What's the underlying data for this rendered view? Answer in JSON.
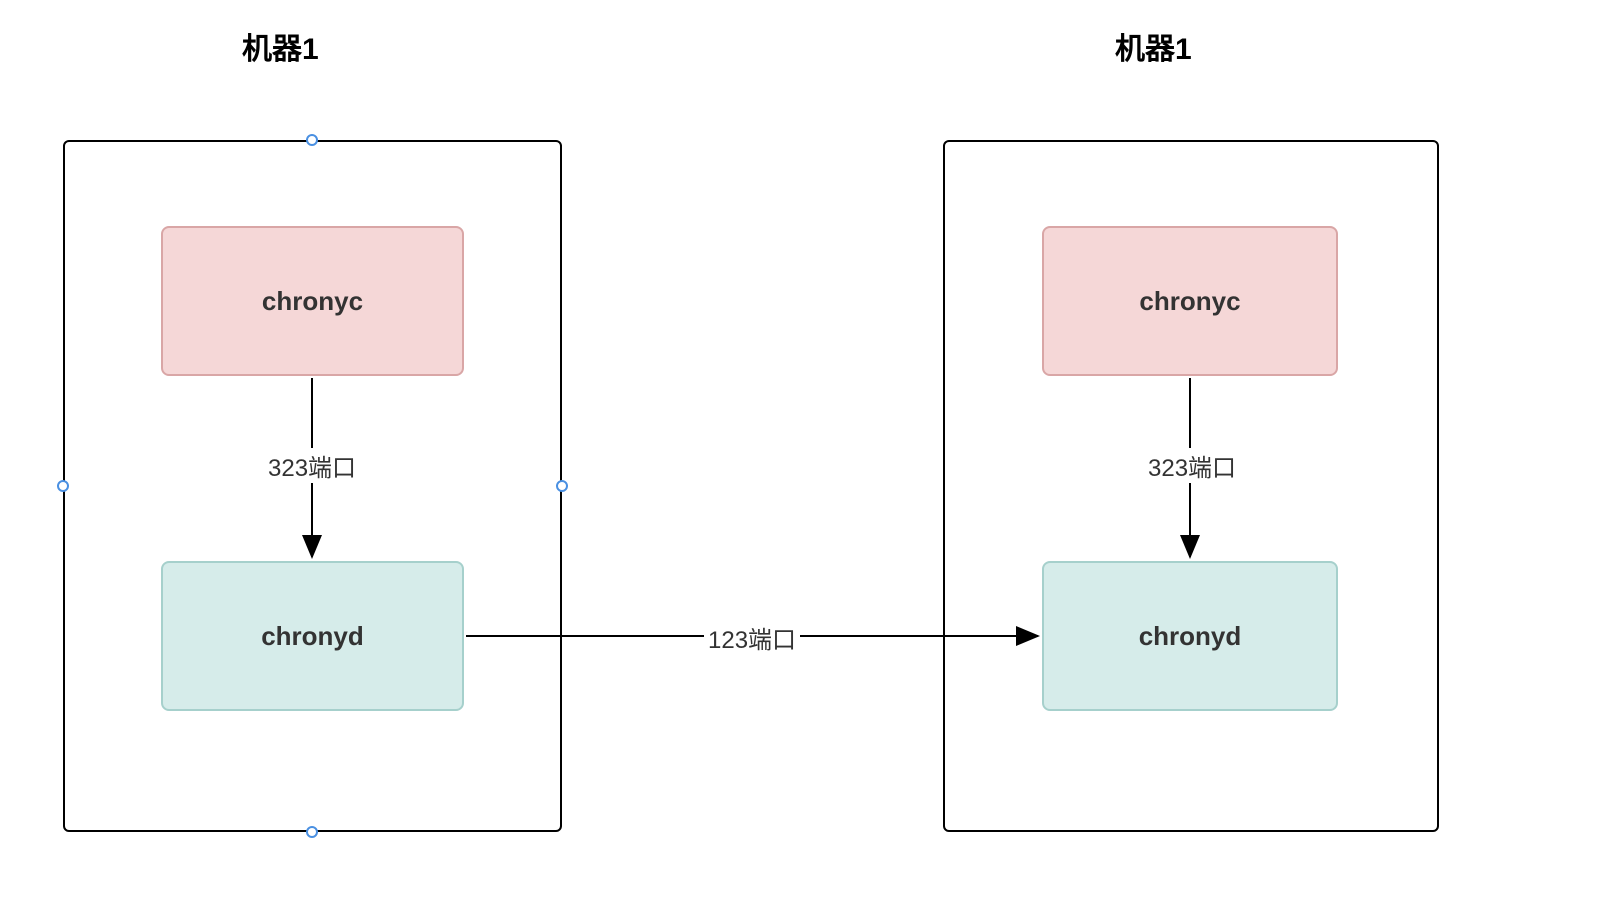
{
  "titles": {
    "machine1_left": "机器1",
    "machine1_right": "机器1"
  },
  "nodes": {
    "chronyc_left": "chronyc",
    "chronyd_left": "chronyd",
    "chronyc_right": "chronyc",
    "chronyd_right": "chronyd"
  },
  "edges": {
    "port323_left": "323端口",
    "port323_right": "323端口",
    "port123_center": "123端口"
  },
  "colors": {
    "chronyc_bg": "#f5d7d7",
    "chronyc_border": "#d9a6a6",
    "chronyd_bg": "#d6ecea",
    "chronyd_border": "#a6d0cc",
    "handle_border": "#4a90e2"
  }
}
